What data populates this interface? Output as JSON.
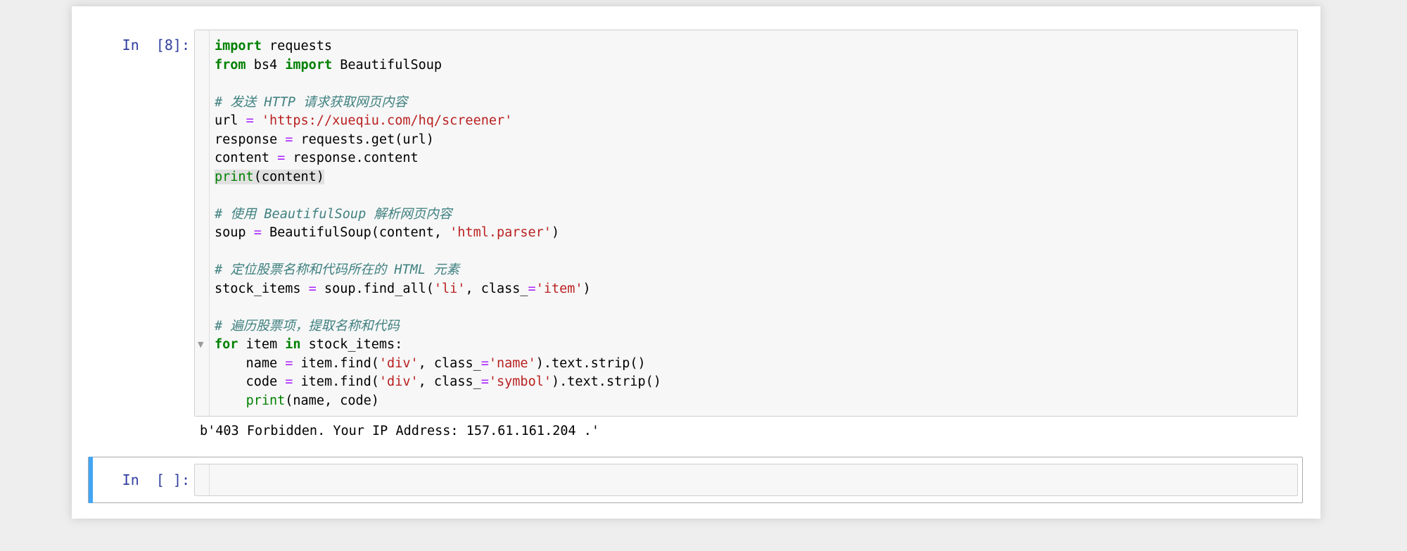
{
  "cells": [
    {
      "prompt": "In  [8]:",
      "lines": [
        [
          {
            "t": "import",
            "c": "kw"
          },
          {
            "t": " requests"
          }
        ],
        [
          {
            "t": "from",
            "c": "kw"
          },
          {
            "t": " bs4 "
          },
          {
            "t": "import",
            "c": "kw"
          },
          {
            "t": " BeautifulSoup"
          }
        ],
        [],
        [
          {
            "t": "# 发送 HTTP 请求获取网页内容",
            "c": "cm"
          }
        ],
        [
          {
            "t": "url "
          },
          {
            "t": "=",
            "c": "op"
          },
          {
            "t": " "
          },
          {
            "t": "'https://xueqiu.com/hq/screener'",
            "c": "str"
          }
        ],
        [
          {
            "t": "response "
          },
          {
            "t": "=",
            "c": "op"
          },
          {
            "t": " requests.get(url)"
          }
        ],
        [
          {
            "t": "content "
          },
          {
            "t": "=",
            "c": "op"
          },
          {
            "t": " response.content"
          }
        ],
        [
          {
            "t": "print",
            "c": "bi sel"
          },
          {
            "t": "(content)",
            "c": "sel"
          }
        ],
        [],
        [
          {
            "t": "# 使用 BeautifulSoup 解析网页内容",
            "c": "cm"
          }
        ],
        [
          {
            "t": "soup "
          },
          {
            "t": "=",
            "c": "op"
          },
          {
            "t": " BeautifulSoup(content, "
          },
          {
            "t": "'html.parser'",
            "c": "str"
          },
          {
            "t": ")"
          }
        ],
        [],
        [
          {
            "t": "# 定位股票名称和代码所在的 HTML 元素",
            "c": "cm"
          }
        ],
        [
          {
            "t": "stock_items "
          },
          {
            "t": "=",
            "c": "op"
          },
          {
            "t": " soup.find_all("
          },
          {
            "t": "'li'",
            "c": "str"
          },
          {
            "t": ", class_"
          },
          {
            "t": "=",
            "c": "op"
          },
          {
            "t": "'item'",
            "c": "str"
          },
          {
            "t": ")"
          }
        ],
        [],
        [
          {
            "t": "# 遍历股票项，提取名称和代码",
            "c": "cm"
          }
        ],
        [
          {
            "t": "for",
            "c": "kw"
          },
          {
            "t": " item "
          },
          {
            "t": "in",
            "c": "kw"
          },
          {
            "t": " stock_items:"
          }
        ],
        [
          {
            "t": "    name "
          },
          {
            "t": "=",
            "c": "op"
          },
          {
            "t": " item.find("
          },
          {
            "t": "'div'",
            "c": "str"
          },
          {
            "t": ", class_"
          },
          {
            "t": "=",
            "c": "op"
          },
          {
            "t": "'name'",
            "c": "str"
          },
          {
            "t": ").text.strip()"
          }
        ],
        [
          {
            "t": "    code "
          },
          {
            "t": "=",
            "c": "op"
          },
          {
            "t": " item.find("
          },
          {
            "t": "'div'",
            "c": "str"
          },
          {
            "t": ", class_"
          },
          {
            "t": "=",
            "c": "op"
          },
          {
            "t": "'symbol'",
            "c": "str"
          },
          {
            "t": ").text.strip()"
          }
        ],
        [
          {
            "t": "    "
          },
          {
            "t": "print",
            "c": "bi"
          },
          {
            "t": "(name, code)"
          }
        ]
      ],
      "output": "b'403 Forbidden. Your IP Address: 157.61.161.204 .'"
    },
    {
      "prompt": "In  [ ]:",
      "value": ""
    }
  ],
  "fold_marker": "▼",
  "colors": {
    "keyword": "#008000",
    "operator": "#aa22ff",
    "string": "#ba2121",
    "comment": "#408080",
    "prompt": "#303f9f",
    "selected_cell_bar": "#42a5f5"
  }
}
